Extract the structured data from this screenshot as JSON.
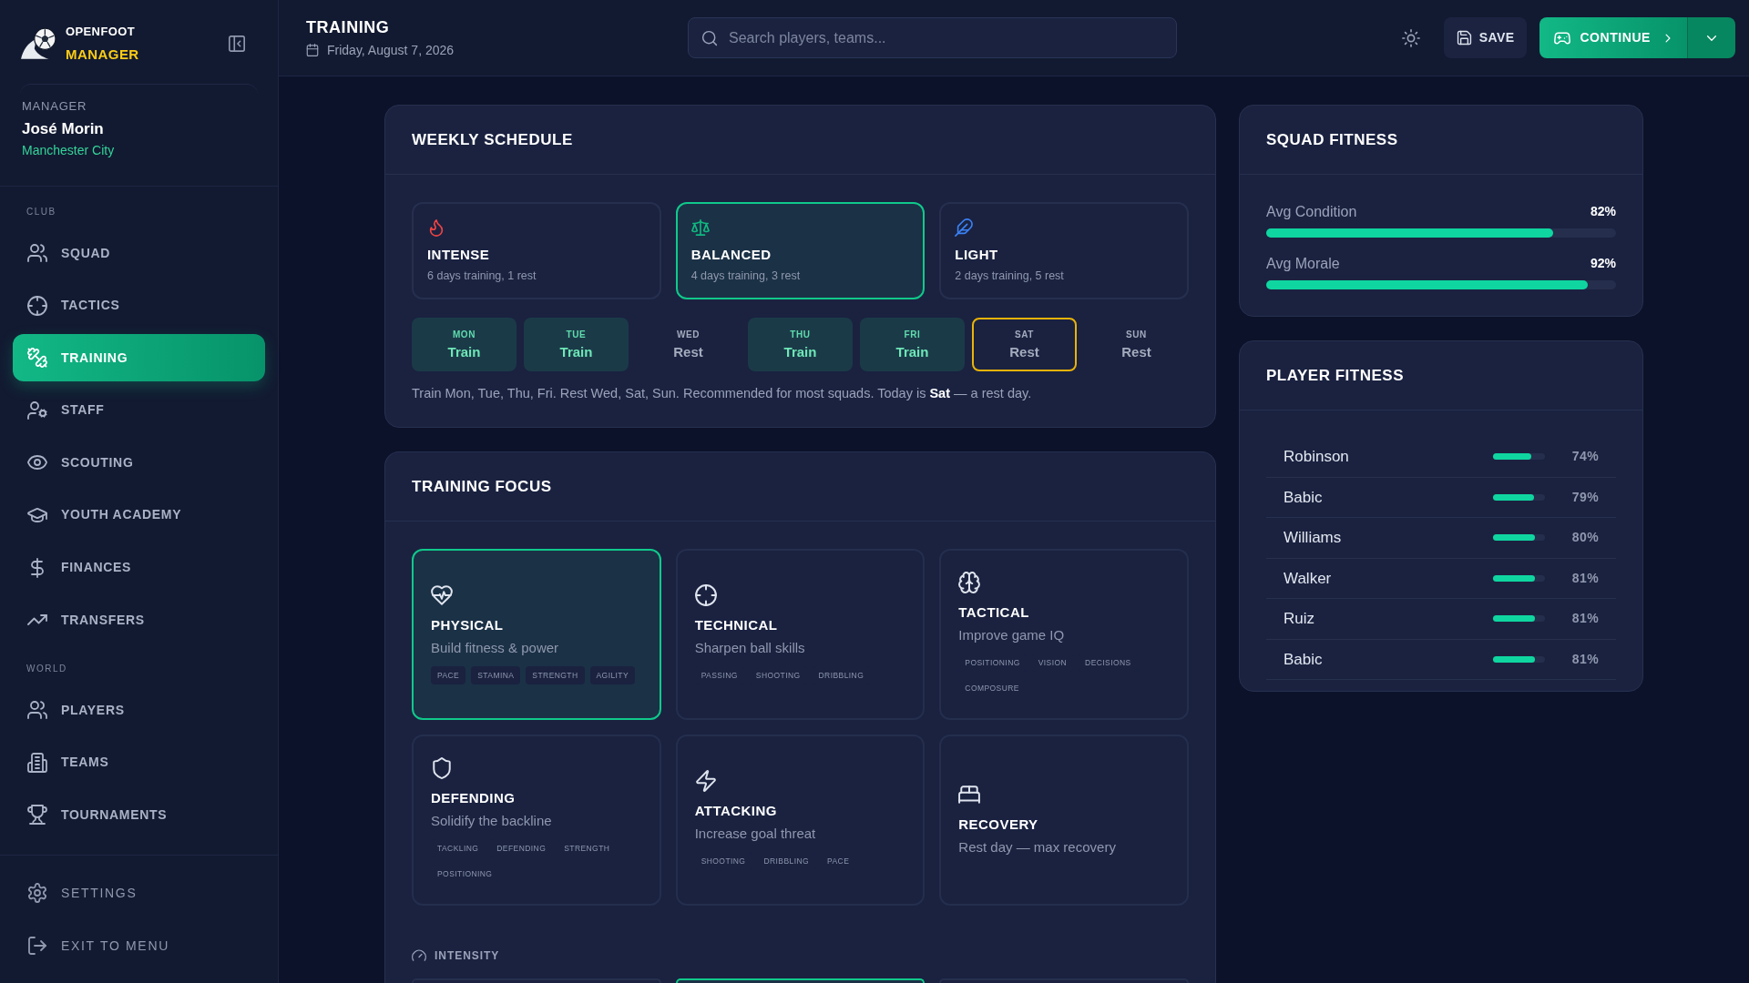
{
  "sidebar": {
    "logo": {
      "line_1": "OPENFOOT",
      "line_2": "MANAGER"
    },
    "manager": {
      "label": "MANAGER",
      "name": "José Morin",
      "club": "Manchester City"
    },
    "sections": [
      {
        "heading": "CLUB",
        "items": [
          {
            "label": "SQUAD",
            "selected": false
          },
          {
            "label": "TACTICS",
            "selected": false
          },
          {
            "label": "TRAINING",
            "selected": true
          },
          {
            "label": "STAFF",
            "selected": false
          },
          {
            "label": "SCOUTING",
            "selected": false
          },
          {
            "label": "YOUTH ACADEMY",
            "selected": false
          },
          {
            "label": "FINANCES",
            "selected": false
          },
          {
            "label": "TRANSFERS",
            "selected": false
          }
        ]
      },
      {
        "heading": "WORLD",
        "items": [
          {
            "label": "PLAYERS",
            "selected": false
          },
          {
            "label": "TEAMS",
            "selected": false
          },
          {
            "label": "TOURNAMENTS",
            "selected": false
          }
        ]
      }
    ],
    "footer_items": [
      {
        "label": "SETTINGS"
      },
      {
        "label": "EXIT TO MENU"
      }
    ]
  },
  "header": {
    "title": "TRAINING",
    "date": "Friday, August 7, 2026",
    "search": {
      "placeholder": "Search players, teams..."
    },
    "save_button": {
      "label": "SAVE"
    },
    "continue_button": {
      "label": "CONTINUE"
    }
  },
  "weekly_schedule": {
    "title": "WEEKLY SCHEDULE",
    "presets": [
      {
        "name": "INTENSE",
        "description": "6 days training, 1 rest",
        "selected": false
      },
      {
        "name": "BALANCED",
        "description": "4 days training, 3 rest",
        "selected": true
      },
      {
        "name": "LIGHT",
        "description": "2 days training, 5 rest",
        "selected": false
      }
    ],
    "days": [
      {
        "day": "MON",
        "plan": "Train",
        "training": true,
        "today": false
      },
      {
        "day": "TUE",
        "plan": "Train",
        "training": true,
        "today": false
      },
      {
        "day": "WED",
        "plan": "Rest",
        "training": false,
        "today": false
      },
      {
        "day": "THU",
        "plan": "Train",
        "training": true,
        "today": false
      },
      {
        "day": "FRI",
        "plan": "Train",
        "training": true,
        "today": false
      },
      {
        "day": "SAT",
        "plan": "Rest",
        "training": false,
        "today": true
      },
      {
        "day": "SUN",
        "plan": "Rest",
        "training": false,
        "today": false
      }
    ],
    "summary": "Train Mon, Tue, Thu, Fri. Rest Wed, Sat, Sun. Recommended for most squads. Today is **Sat** — a rest day."
  },
  "training_focus": {
    "title": "TRAINING FOCUS",
    "options": [
      {
        "name": "PHYSICAL",
        "description": "Build fitness & power",
        "tags": [
          "PACE",
          "STAMINA",
          "STRENGTH",
          "AGILITY"
        ],
        "selected": true
      },
      {
        "name": "TECHNICAL",
        "description": "Sharpen ball skills",
        "tags": [
          "PASSING",
          "SHOOTING",
          "DRIBBLING"
        ],
        "selected": false
      },
      {
        "name": "TACTICAL",
        "description": "Improve game IQ",
        "tags": [
          "POSITIONING",
          "VISION",
          "DECISIONS",
          "COMPOSURE"
        ],
        "selected": false
      },
      {
        "name": "DEFENDING",
        "description": "Solidify the backline",
        "tags": [
          "TACKLING",
          "DEFENDING",
          "STRENGTH",
          "POSITIONING"
        ],
        "selected": false
      },
      {
        "name": "ATTACKING",
        "description": "Increase goal threat",
        "tags": [
          "SHOOTING",
          "DRIBBLING",
          "PACE"
        ],
        "selected": false
      },
      {
        "name": "RECOVERY",
        "description": "Rest day — max recovery",
        "selected": false
      }
    ],
    "intensity": {
      "label": "INTENSITY",
      "options": [
        {
          "selected": false
        },
        {
          "selected": true
        },
        {
          "selected": false
        }
      ]
    }
  },
  "squad_fitness": {
    "title": "SQUAD FITNESS",
    "metrics": [
      {
        "label": "Avg Condition",
        "value": "82%",
        "level": 0.82
      },
      {
        "label": "Avg Morale",
        "value": "92%",
        "level": 0.92
      }
    ]
  },
  "player_fitness": {
    "title": "PLAYER FITNESS",
    "players": [
      {
        "name": "Robinson",
        "value": "74%",
        "level": 0.74
      },
      {
        "name": "Babic",
        "value": "79%",
        "level": 0.79
      },
      {
        "name": "Williams",
        "value": "80%",
        "level": 0.8
      },
      {
        "name": "Walker",
        "value": "81%",
        "level": 0.81
      },
      {
        "name": "Ruiz",
        "value": "81%",
        "level": 0.81
      },
      {
        "name": "Babic",
        "value": "81%",
        "level": 0.81
      }
    ]
  }
}
